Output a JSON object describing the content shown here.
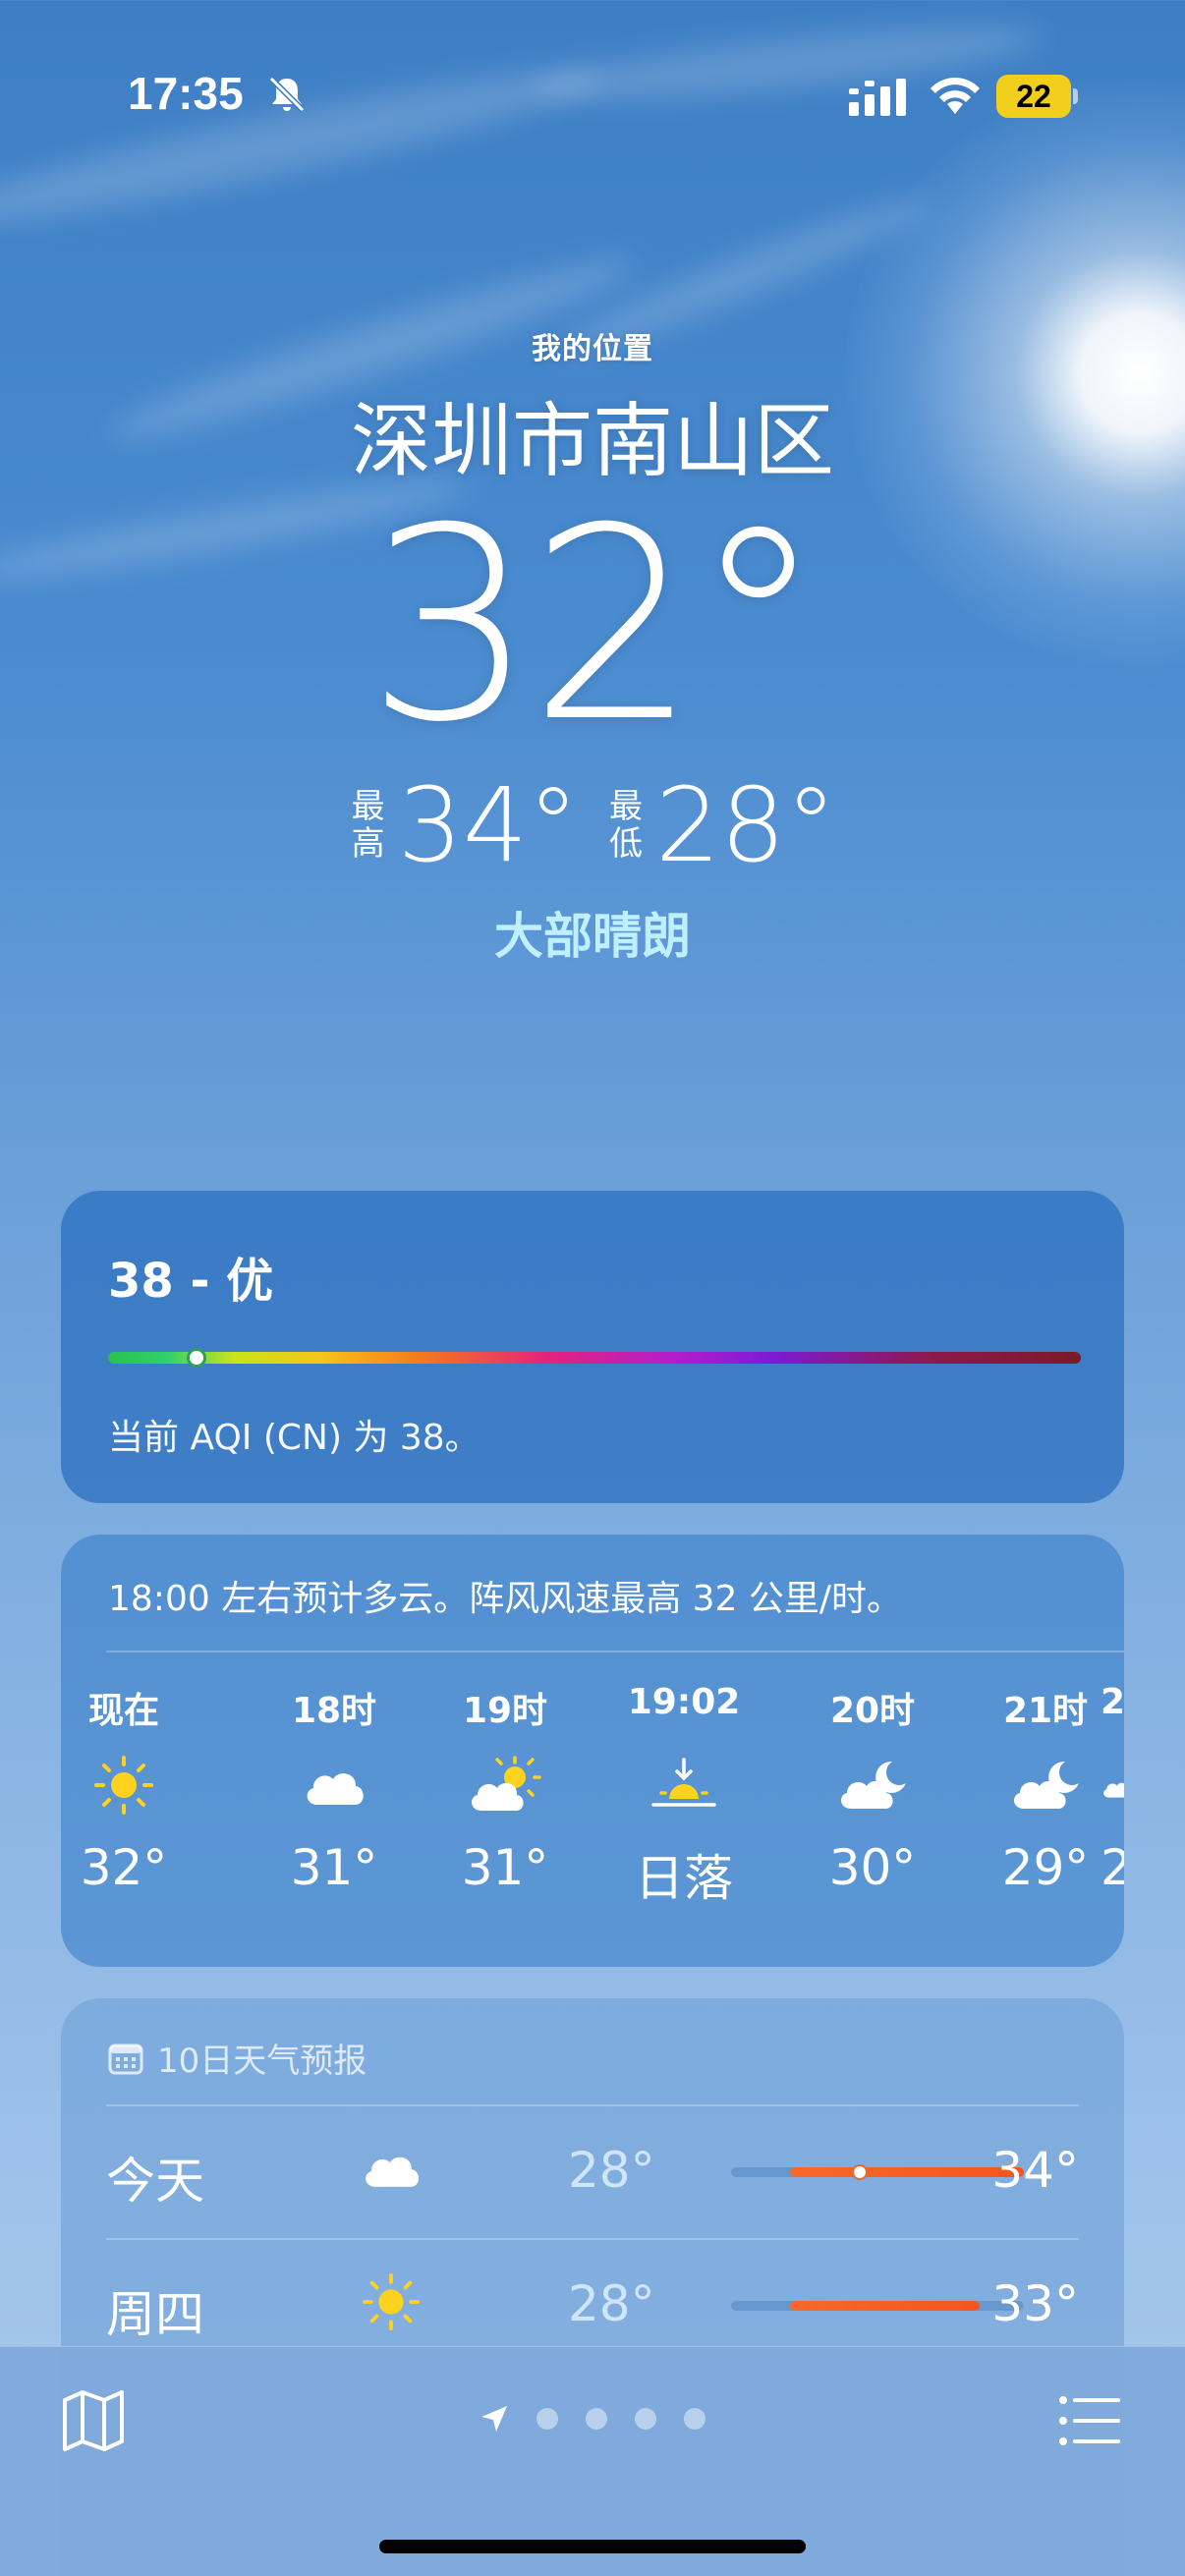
{
  "status_bar": {
    "time": "17:35",
    "battery": "22",
    "icons": [
      "bell-slash-icon",
      "cellular-signal-icon",
      "wifi-icon",
      "battery-icon"
    ],
    "battery_color": "#f2cf1c"
  },
  "location": {
    "label": "我的位置",
    "city": "深圳市南山区"
  },
  "current": {
    "temp": "32°",
    "high_label": "最高",
    "high": "34°",
    "low_label": "最低",
    "low": "28°",
    "condition": "大部晴朗"
  },
  "aqi": {
    "title": "38 - 优",
    "value": 38,
    "description": "当前 AQI (CN) 为 38。"
  },
  "hourly": {
    "summary": "18:00 左右预计多云。阵风风速最高 32 公里/时。",
    "items": [
      {
        "label": "现在",
        "icon": "sun-icon",
        "value": "32°"
      },
      {
        "label": "18时",
        "icon": "cloud-icon",
        "value": "31°"
      },
      {
        "label": "19时",
        "icon": "partly-sunny-icon",
        "value": "31°"
      },
      {
        "label": "19:02",
        "icon": "sunset-icon",
        "value": "日落"
      },
      {
        "label": "20时",
        "icon": "cloud-moon-icon",
        "value": "30°"
      },
      {
        "label": "21时",
        "icon": "cloud-moon-icon",
        "value": "29°"
      },
      {
        "label": "2",
        "icon": "cloud-moon-icon",
        "value": "2"
      }
    ]
  },
  "forecast": {
    "header": "10日天气预报",
    "range_min": 28,
    "range_max": 34,
    "rows": [
      {
        "day": "今天",
        "icon": "cloud-icon",
        "low": "28°",
        "high": "34°",
        "bar_from": 0.2,
        "bar_to": 1.0,
        "current_marker": 0.44
      },
      {
        "day": "周四",
        "icon": "sun-icon",
        "low": "28°",
        "high": "33°",
        "bar_from": 0.2,
        "bar_to": 0.85
      }
    ]
  },
  "toolbar": {
    "icons": [
      "map-icon",
      "location-arrow-icon",
      "list-icon"
    ],
    "page_count": 4
  }
}
